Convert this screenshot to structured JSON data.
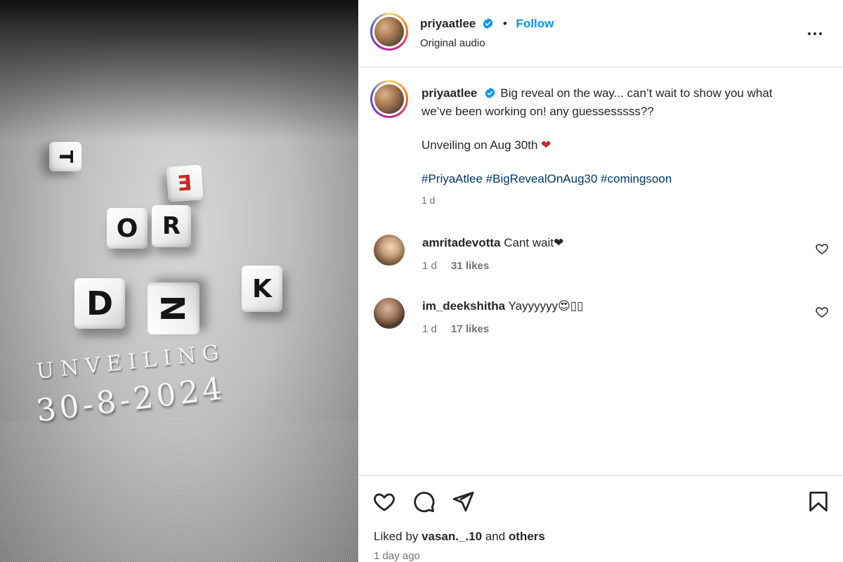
{
  "media": {
    "dice": [
      {
        "letter": "T"
      },
      {
        "letter": "E"
      },
      {
        "letter": "O"
      },
      {
        "letter": "R"
      },
      {
        "letter": "D"
      },
      {
        "letter": "N"
      },
      {
        "letter": "K"
      }
    ],
    "unveiling_label": "UNVEILING",
    "unveiling_date": "30-8-2024"
  },
  "header": {
    "username": "priyaatlee",
    "separator": "•",
    "follow_label": "Follow",
    "subtitle": "Original audio"
  },
  "caption": {
    "username": "priyaatlee",
    "text_line1": "Big reveal on the way... can’t wait to show you what",
    "text_line2": "we’ve been working on! any guessesssss??",
    "unveiling_text": "Unveiling on Aug 30th",
    "heart_emoji": "❤",
    "hashtags": "#PriyaAtlee #BigRevealOnAug30 #comingsoon",
    "time": "1 d"
  },
  "comments": [
    {
      "username": "amritadevotta",
      "text": "Cant wait❤",
      "time": "1 d",
      "likes": "31 likes"
    },
    {
      "username": "im_deekshitha",
      "text": "Yayyyyyy😍▯▯",
      "time": "1 d",
      "likes": "17 likes"
    }
  ],
  "footer": {
    "liked_by_prefix": "Liked by",
    "liked_by_user": "vasan._.10",
    "liked_by_and": "and",
    "liked_by_others": "others",
    "posted": "1 day ago"
  },
  "colors": {
    "accent": "#0095f6",
    "hashtag": "#00376b",
    "heart": "#c62828"
  }
}
